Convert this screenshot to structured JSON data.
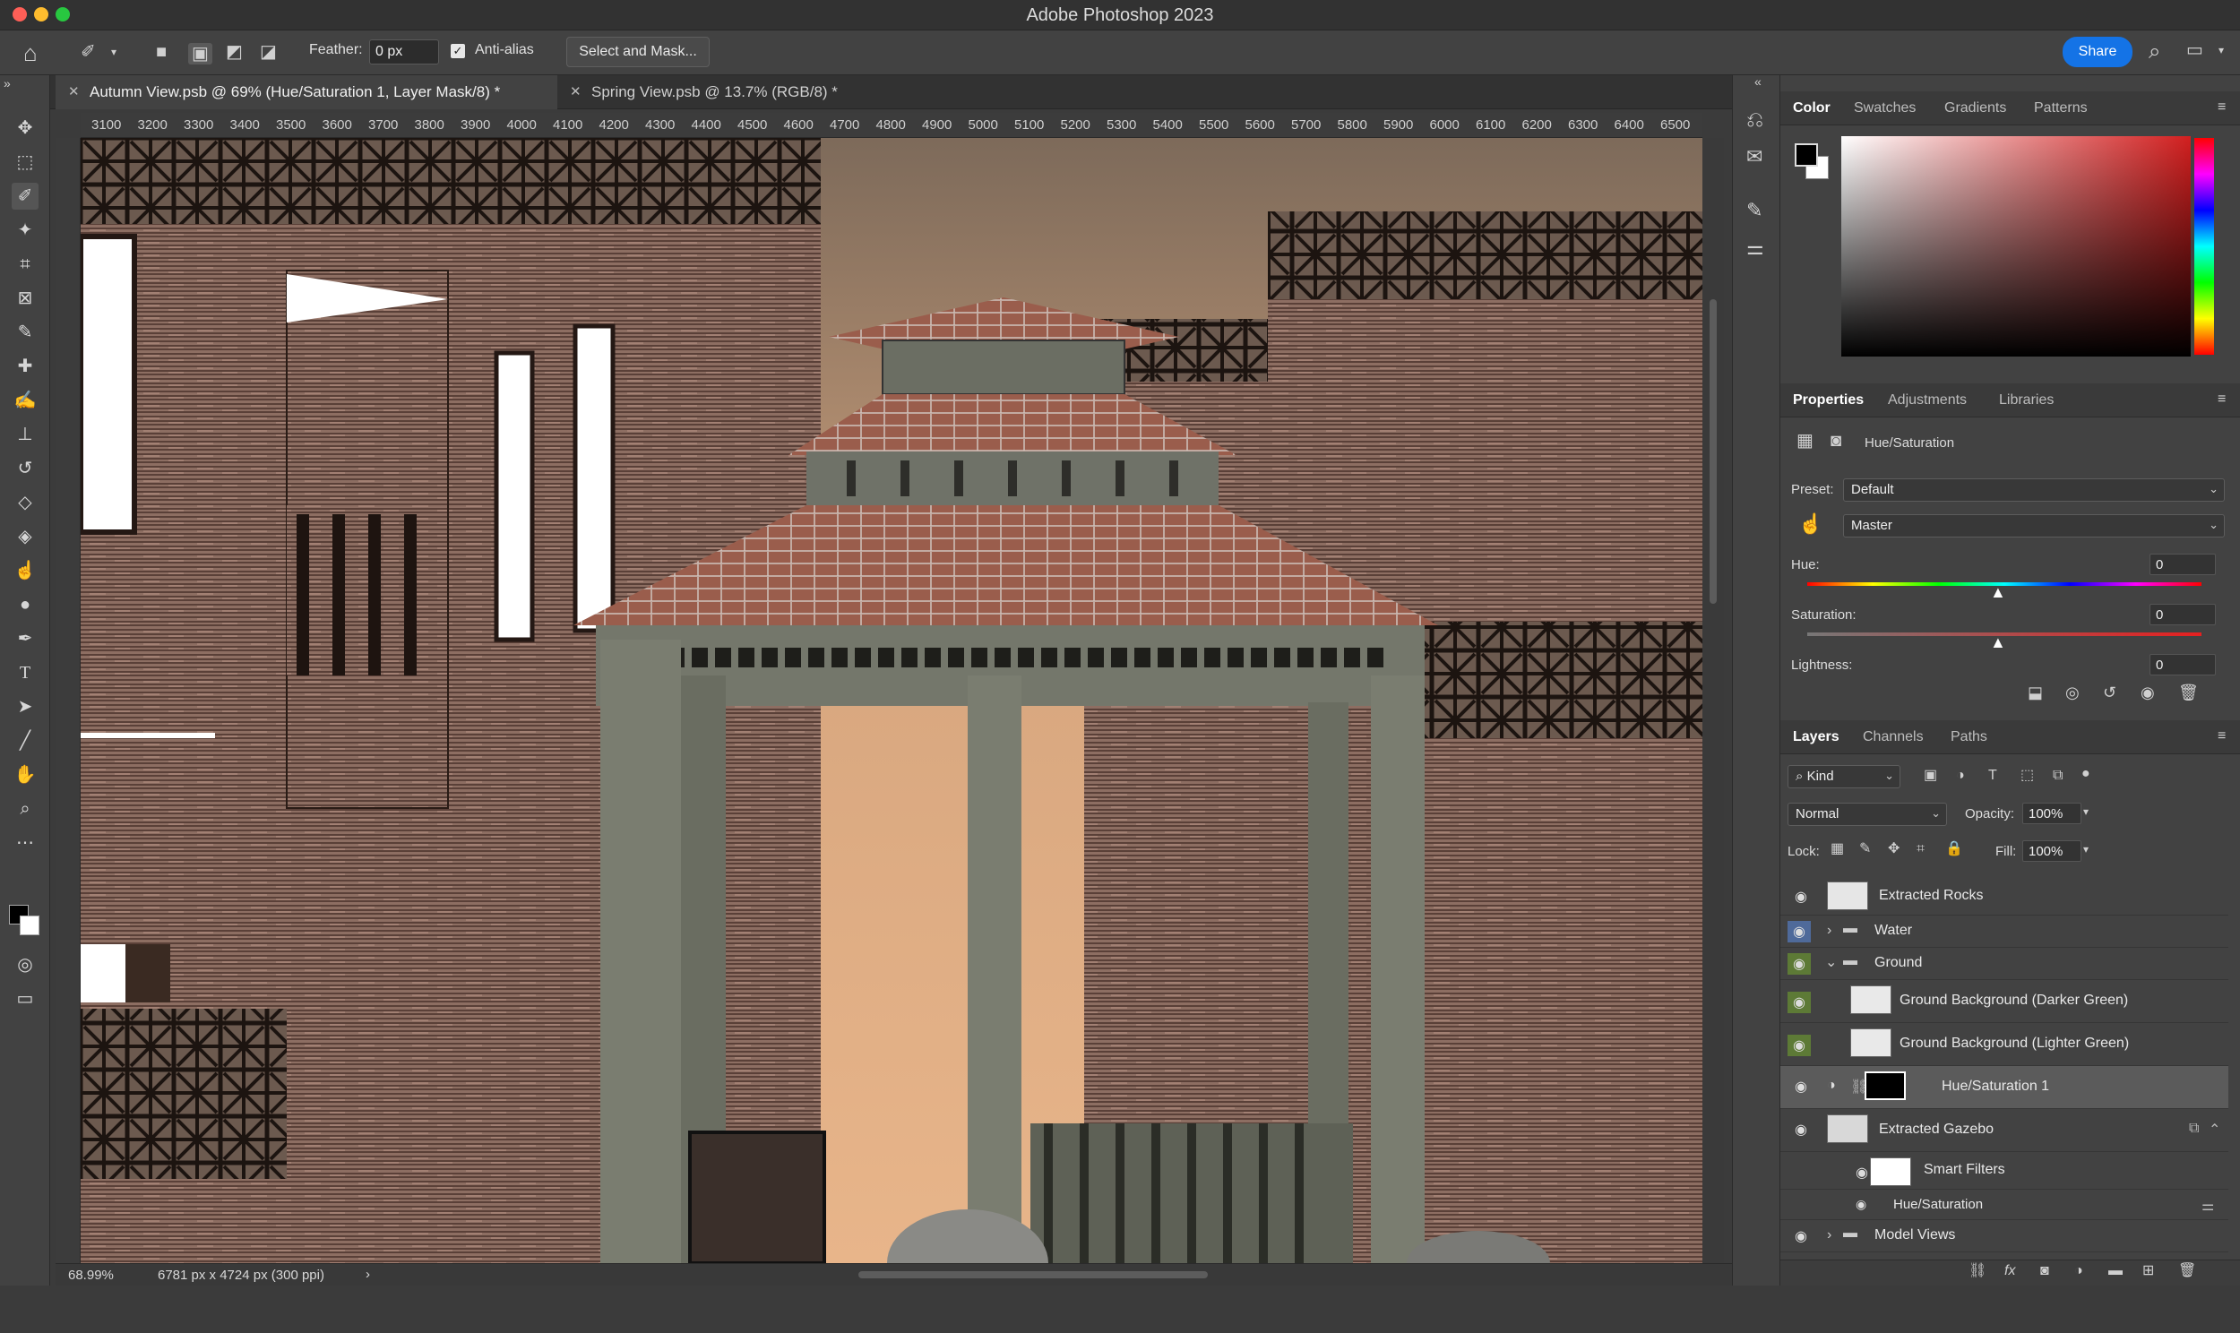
{
  "window": {
    "title": "Adobe Photoshop 2023"
  },
  "options": {
    "feather_label": "Feather:",
    "feather_value": "0 px",
    "antialias_label": "Anti-alias",
    "select_mask_label": "Select and Mask...",
    "share_label": "Share"
  },
  "documents": {
    "tabs": [
      {
        "label": "Autumn View.psb @ 69% (Hue/Saturation 1, Layer Mask/8) *",
        "active": true
      },
      {
        "label": "Spring View.psb @ 13.7% (RGB/8) *",
        "active": false
      }
    ]
  },
  "ruler": {
    "ticks": [
      "3100",
      "3200",
      "3300",
      "3400",
      "3500",
      "3600",
      "3700",
      "3800",
      "3900",
      "4000",
      "4100",
      "4200",
      "4300",
      "4400",
      "4500",
      "4600",
      "4700",
      "4800",
      "4900",
      "5000",
      "5100",
      "5200",
      "5300",
      "5400",
      "5500",
      "5600",
      "5700",
      "5800",
      "5900",
      "6000",
      "6100",
      "6200",
      "6300",
      "6400",
      "6500"
    ]
  },
  "status": {
    "zoom": "68.99%",
    "doc_info": "6781 px x 4724 px (300 ppi)"
  },
  "color_panel": {
    "tabs": [
      "Color",
      "Swatches",
      "Gradients",
      "Patterns"
    ],
    "fg": "#000000",
    "bg": "#ffffff"
  },
  "properties": {
    "tabs": [
      "Properties",
      "Adjustments",
      "Libraries"
    ],
    "layer_type": "Hue/Saturation",
    "preset_label": "Preset:",
    "preset_value": "Default",
    "channel_value": "Master",
    "hue_label": "Hue:",
    "hue_value": "0",
    "saturation_label": "Saturation:",
    "saturation_value": "0",
    "lightness_label": "Lightness:",
    "lightness_value": "0"
  },
  "layers_panel": {
    "tabs": [
      "Layers",
      "Channels",
      "Paths"
    ],
    "filter_kind": "Kind",
    "blend_mode": "Normal",
    "opacity_label": "Opacity:",
    "opacity_value": "100%",
    "lock_label": "Lock:",
    "fill_label": "Fill:",
    "fill_value": "100%",
    "layers": [
      {
        "name": "Extracted Rocks"
      },
      {
        "name": "Water"
      },
      {
        "name": "Ground"
      },
      {
        "name": "Ground Background (Darker Green)"
      },
      {
        "name": "Ground Background (Lighter Green)"
      },
      {
        "name": "Hue/Saturation 1"
      },
      {
        "name": "Extracted Gazebo"
      },
      {
        "name": "Smart Filters"
      },
      {
        "name": "Hue/Saturation"
      },
      {
        "name": "Model Views"
      }
    ]
  },
  "icons": {
    "home": "home-icon",
    "lasso": "polygonal-lasso-icon",
    "search": "search-icon"
  }
}
